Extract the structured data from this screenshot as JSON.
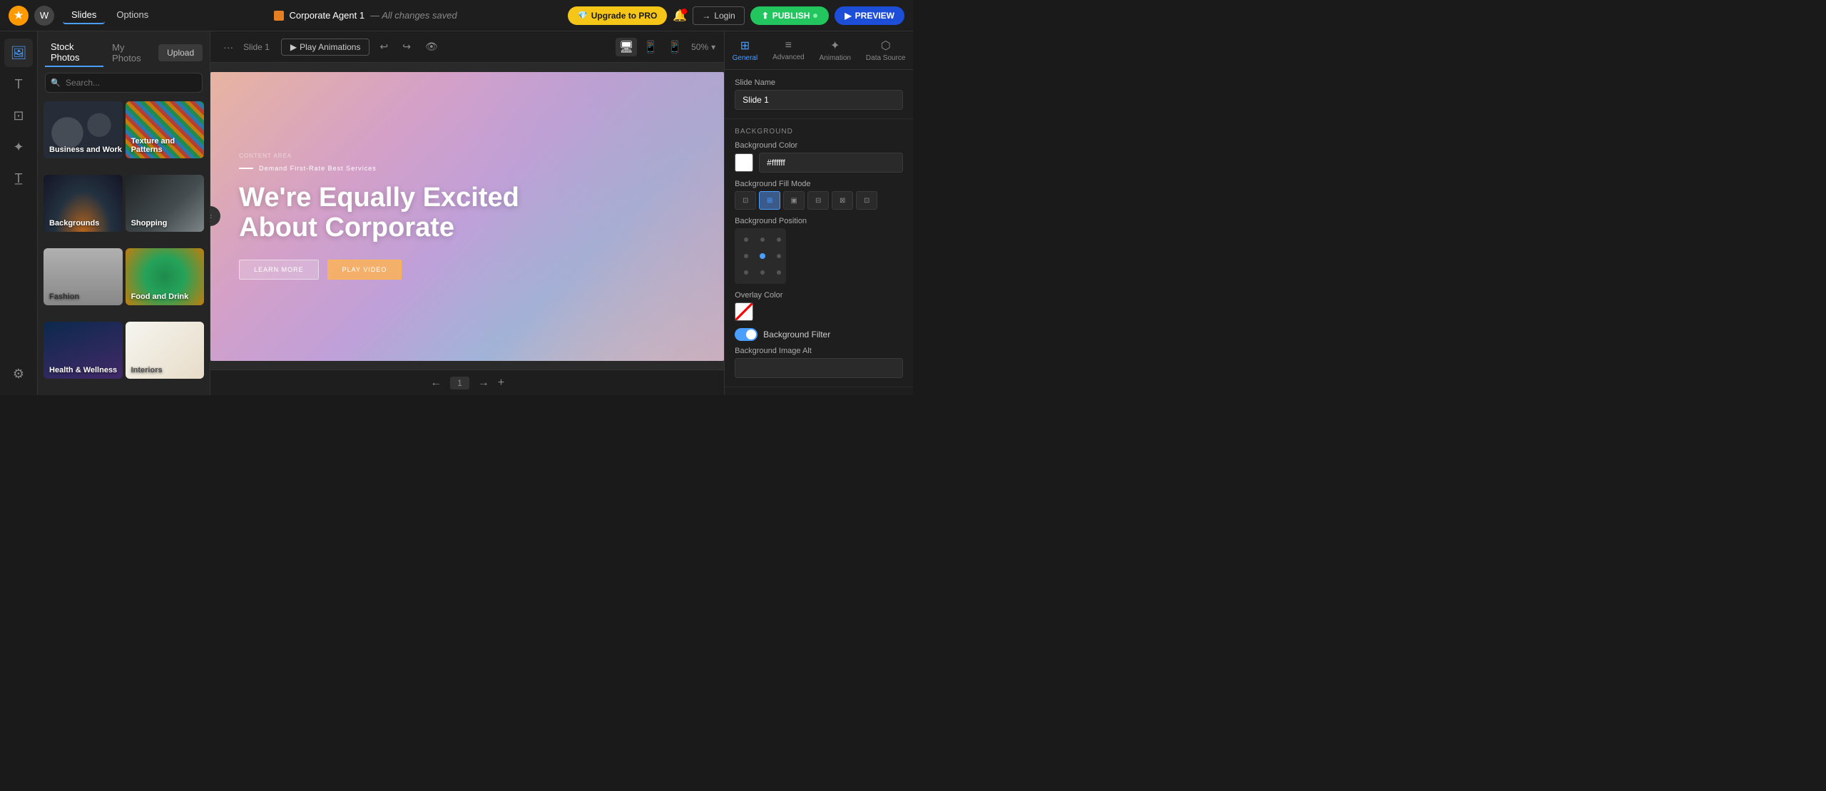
{
  "app": {
    "logo": "★",
    "wp_logo": "W"
  },
  "topbar": {
    "nav": [
      {
        "label": "Slides",
        "active": true
      },
      {
        "label": "Options",
        "active": false
      }
    ],
    "file_name": "Corporate Agent 1",
    "save_status": "— All changes saved",
    "upgrade_label": "Upgrade to PRO",
    "login_label": "Login",
    "publish_label": "PUBLISH",
    "preview_label": "PREVIEW"
  },
  "toolbar": {
    "slide_label": "Slide 1",
    "play_anim_label": "Play Animations",
    "zoom": "50%",
    "undo_icon": "↩",
    "redo_icon": "↪",
    "eye_icon": "👁"
  },
  "photos_panel": {
    "tab_stock": "Stock Photos",
    "tab_my": "My Photos",
    "upload_label": "Upload",
    "search_placeholder": "Search...",
    "categories": [
      {
        "label": "Business and Work",
        "bg_class": "pc-biz-detail"
      },
      {
        "label": "Texture and Patterns",
        "bg_class": "pc-tex-detail"
      },
      {
        "label": "Backgrounds",
        "bg_class": "pc-bg-detail"
      },
      {
        "label": "Shopping",
        "bg_class": "pc-shop-detail"
      },
      {
        "label": "Fashion",
        "bg_class": "pc-fash-detail"
      },
      {
        "label": "Food and Drink",
        "bg_class": "pc-food-detail"
      },
      {
        "label": "Health & Wellness",
        "bg_class": "pc-hlth-detail"
      },
      {
        "label": "Interiors",
        "bg_class": "pc-int-detail"
      }
    ]
  },
  "canvas": {
    "content_area_label": "CONTENT AREA",
    "tagline": "Demand First-Rate Best Services",
    "headline_line1": "We're Equally Excited",
    "headline_line2": "About Corporate",
    "btn_learn": "LEARN MORE",
    "btn_play": "PLAY VIDEO"
  },
  "bottom_bar": {
    "slide_num": "1"
  },
  "right_panel": {
    "tabs": [
      {
        "label": "General",
        "icon": "⊞",
        "active": true
      },
      {
        "label": "Advanced",
        "icon": "≡",
        "active": false
      },
      {
        "label": "Animation",
        "icon": "✦",
        "active": false
      },
      {
        "label": "Data Source",
        "icon": "⬡",
        "active": false
      }
    ],
    "slide_name_label": "Slide Name",
    "slide_name_value": "Slide 1",
    "background_section": "BACKGROUND",
    "bg_color_label": "Background Color",
    "bg_color_value": "#ffffff",
    "bg_fill_label": "Background Fill Mode",
    "fill_modes": [
      "⊡",
      "⊞",
      "▣",
      "⊟",
      "⊠",
      "⊡"
    ],
    "bg_position_label": "Background Position",
    "overlay_color_label": "Overlay Color",
    "bg_filter_label": "Background Filter",
    "bg_alt_label": "Background Image Alt"
  }
}
